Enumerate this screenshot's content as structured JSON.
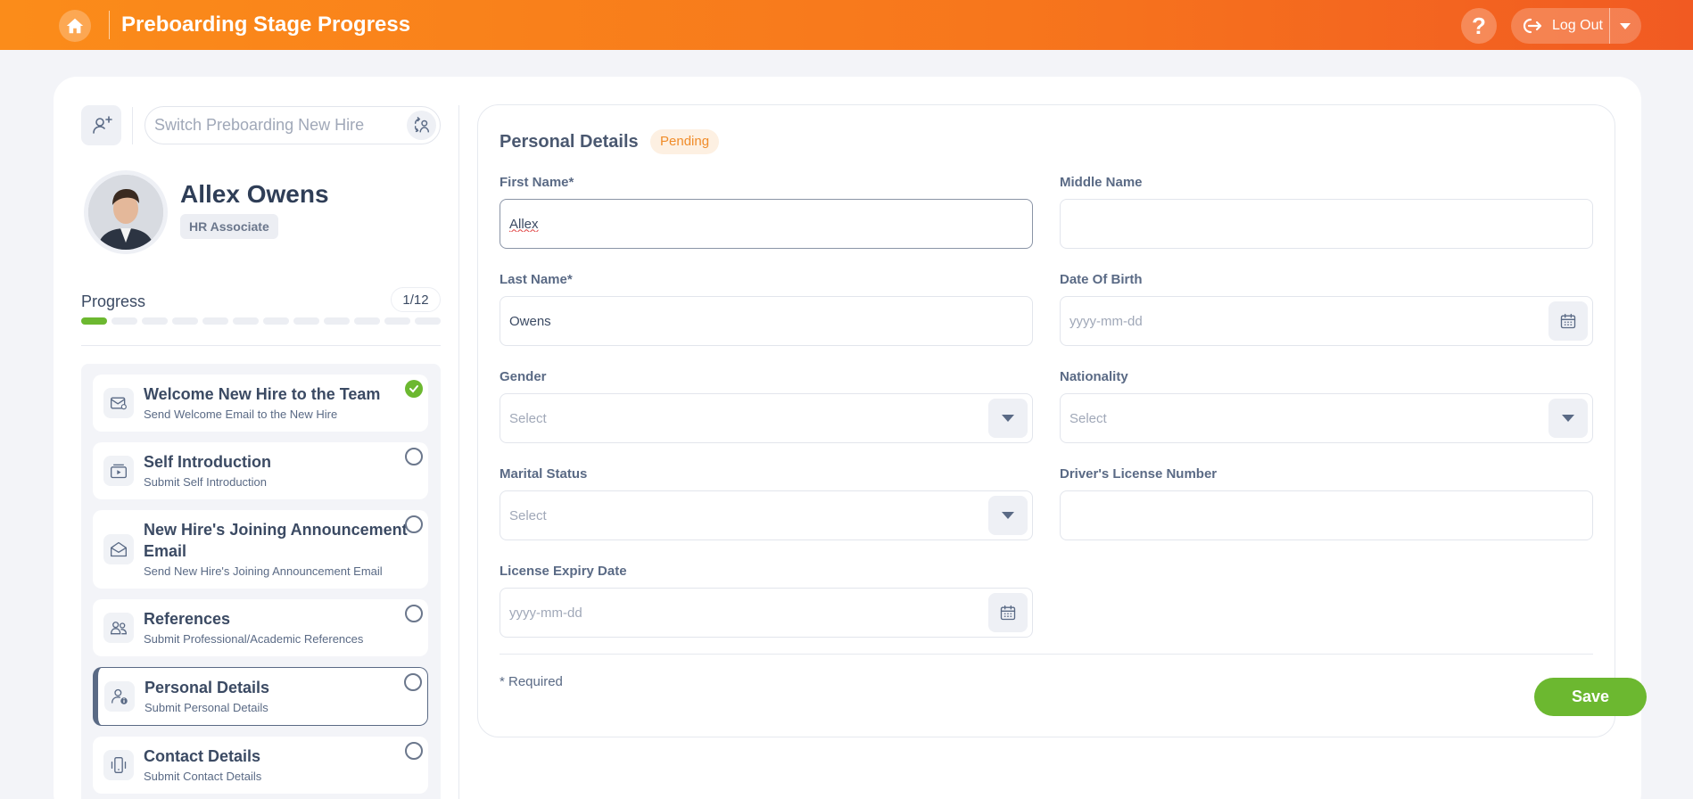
{
  "header": {
    "title": "Preboarding Stage Progress",
    "help_label": "?",
    "logout_label": "Log Out"
  },
  "switcher": {
    "placeholder": "Switch Preboarding New Hire"
  },
  "profile": {
    "name": "Allex Owens",
    "role": "HR Associate"
  },
  "progress": {
    "label": "Progress",
    "count": "1/12",
    "completed": 1,
    "total": 12
  },
  "steps": [
    {
      "title": "Welcome New Hire to the Team",
      "subtitle": "Send Welcome Email to the New Hire",
      "icon": "mail-icon",
      "status": "complete"
    },
    {
      "title": "Self Introduction",
      "subtitle": "Submit Self Introduction",
      "icon": "video-icon",
      "status": "open"
    },
    {
      "title": "New Hire's Joining Announcement Email",
      "subtitle": "Send New Hire's Joining Announcement Email",
      "icon": "envelope-open-icon",
      "status": "open"
    },
    {
      "title": "References",
      "subtitle": "Submit Professional/Academic References",
      "icon": "users-icon",
      "status": "open"
    },
    {
      "title": "Personal Details",
      "subtitle": "Submit Personal Details",
      "icon": "user-info-icon",
      "status": "open",
      "active": true
    },
    {
      "title": "Contact Details",
      "subtitle": "Submit Contact Details",
      "icon": "phone-icon",
      "status": "open"
    }
  ],
  "form": {
    "title": "Personal Details",
    "status": "Pending",
    "first_name": {
      "label": "First Name*",
      "value": "Allex"
    },
    "middle_name": {
      "label": "Middle Name",
      "value": ""
    },
    "last_name": {
      "label": "Last Name*",
      "value": "Owens"
    },
    "dob": {
      "label": "Date Of Birth",
      "placeholder": "yyyy-mm-dd"
    },
    "gender": {
      "label": "Gender",
      "placeholder": "Select"
    },
    "nationality": {
      "label": "Nationality",
      "placeholder": "Select"
    },
    "marital_status": {
      "label": "Marital Status",
      "placeholder": "Select"
    },
    "license_number": {
      "label": "Driver's License Number",
      "value": ""
    },
    "license_expiry": {
      "label": "License Expiry Date",
      "placeholder": "yyyy-mm-dd"
    },
    "required_note": "* Required",
    "save_label": "Save"
  },
  "colors": {
    "header_start": "#fb8c1a",
    "header_end": "#f15a22",
    "success": "#6cb830",
    "pending": "#f08c2a"
  }
}
